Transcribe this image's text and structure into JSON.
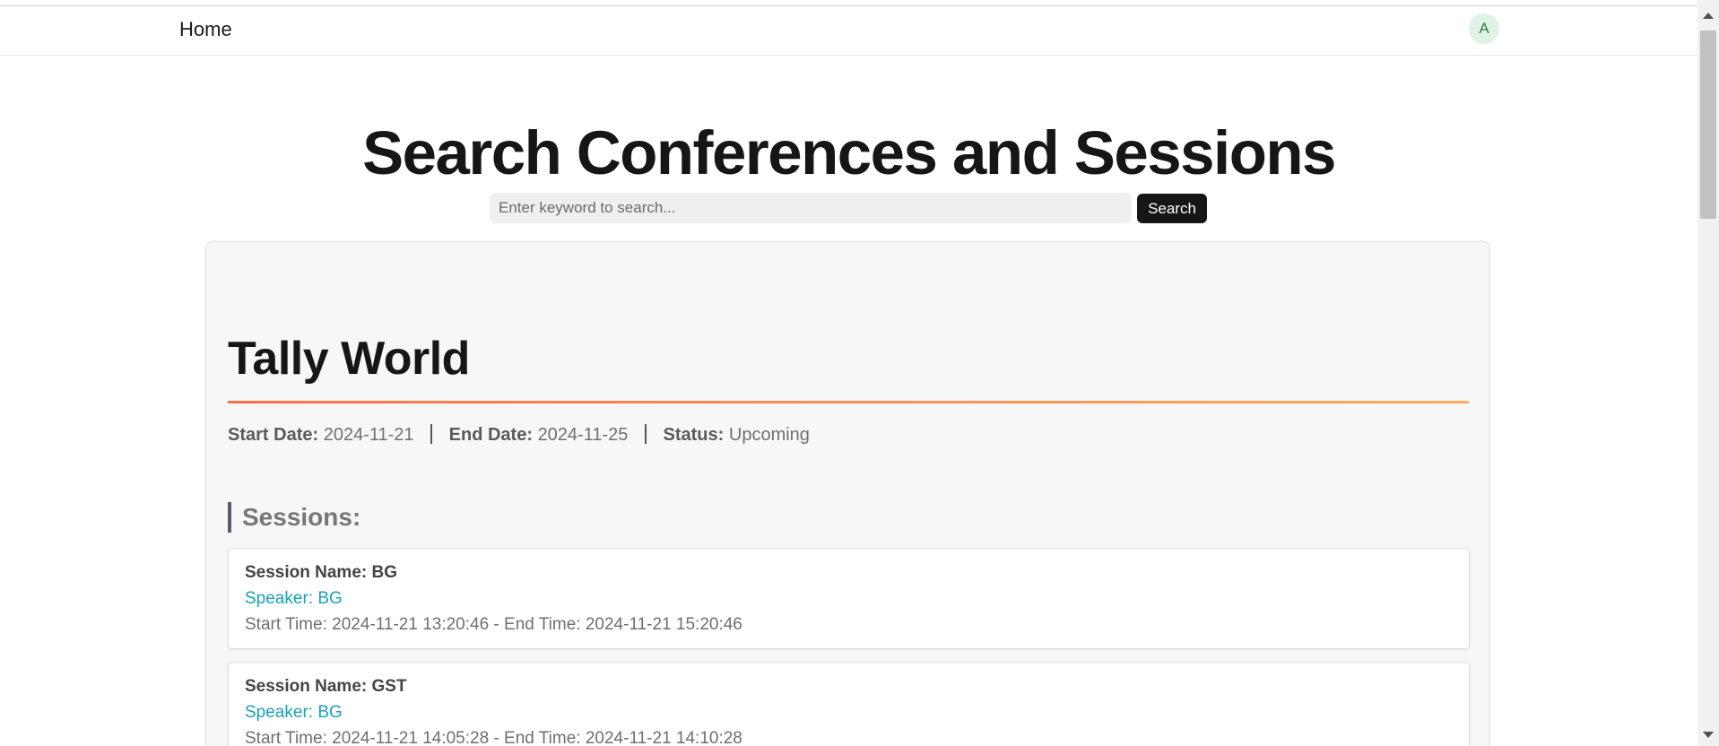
{
  "navbar": {
    "home_label": "Home",
    "avatar_initial": "A"
  },
  "page": {
    "title": "Search Conferences and Sessions"
  },
  "search": {
    "placeholder": "Enter keyword to search...",
    "value": "",
    "button_label": "Search"
  },
  "conference": {
    "title": "Tally World",
    "start_date_label": "Start Date:",
    "start_date": "2024-11-21",
    "end_date_label": "End Date:",
    "end_date": "2024-11-25",
    "status_label": "Status:",
    "status": "Upcoming",
    "sessions_heading": "Sessions:",
    "sessions": [
      {
        "name": "Session Name: BG",
        "speaker": "Speaker: BG",
        "times": "Start Time: 2024-11-21 13:20:46  -  End Time: 2024-11-21 15:20:46"
      },
      {
        "name": "Session Name: GST",
        "speaker": "Speaker: BG",
        "times": "Start Time: 2024-11-21 14:05:28  -  End Time: 2024-11-21 14:10:28"
      }
    ]
  },
  "colors": {
    "accent_rule_start": "#ff7043",
    "accent_rule_end": "#ffab5e",
    "speaker_link": "#17a2b8",
    "search_button": "#161616",
    "avatar_bg": "#dff3e4"
  }
}
